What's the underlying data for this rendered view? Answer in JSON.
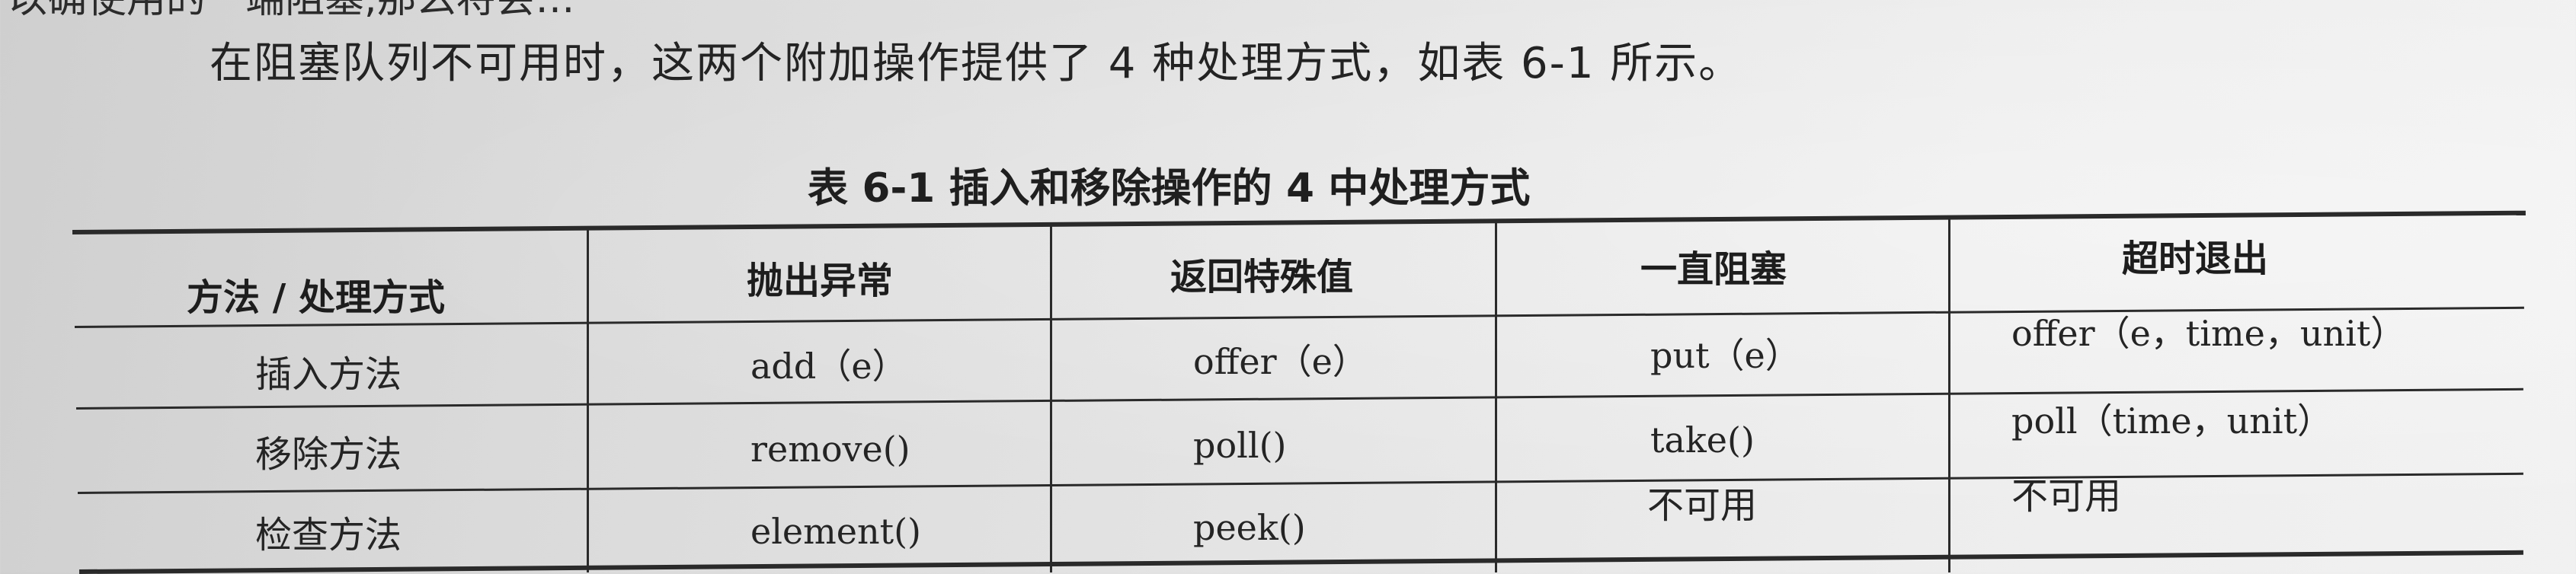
{
  "cut_text": "以确使用的一端阻塞,那么将会…",
  "paragraph": "在阻塞队列不可用时，这两个附加操作提供了 4 种处理方式，如表 6-1 所示。",
  "table": {
    "caption": "表 6-1    插入和移除操作的 4 中处理方式",
    "headers": [
      "方法 / 处理方式",
      "抛出异常",
      "返回特殊值",
      "一直阻塞",
      "超时退出"
    ],
    "rows": [
      [
        "插入方法",
        "add（e）",
        "offer（e）",
        "put（e）",
        "offer（e，time，unit）"
      ],
      [
        "移除方法",
        "remove()",
        "poll()",
        "take()",
        "poll（time，unit）"
      ],
      [
        "检查方法",
        "element()",
        "peek()",
        "不可用",
        "不可用"
      ]
    ]
  }
}
